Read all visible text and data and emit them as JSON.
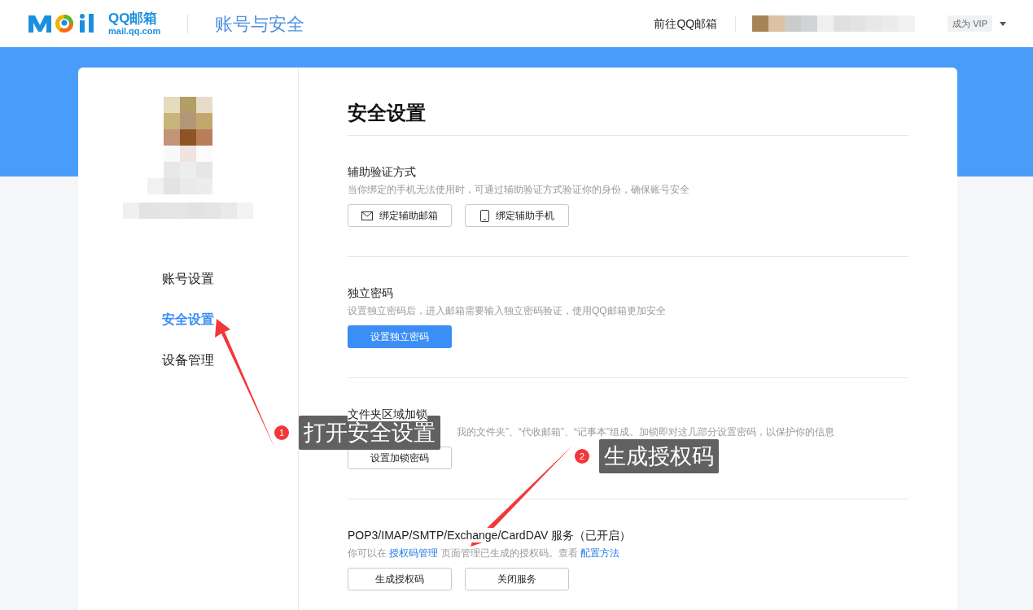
{
  "header": {
    "logo_text": "QQ邮箱",
    "logo_domain": "mail.qq.com",
    "page_title": "账号与安全",
    "goto_link": "前往QQ邮箱",
    "vip_badge": "成为 VIP"
  },
  "sidebar": {
    "items": [
      {
        "label": "账号设置",
        "selected": false
      },
      {
        "label": "安全设置",
        "selected": true
      },
      {
        "label": "设备管理",
        "selected": false
      }
    ]
  },
  "content": {
    "title": "安全设置",
    "sections": [
      {
        "title": "辅助验证方式",
        "description": "当你绑定的手机无法使用时，可通过辅助验证方式验证你的身份，确保账号安全",
        "buttons": [
          {
            "label": "绑定辅助邮箱",
            "kind": "mail"
          },
          {
            "label": "绑定辅助手机",
            "kind": "phone"
          }
        ]
      },
      {
        "title": "独立密码",
        "description": "设置独立密码后，进入邮箱需要输入独立密码验证，使用QQ邮箱更加安全",
        "buttons": [
          {
            "label": "设置独立密码",
            "kind": "primary"
          }
        ]
      },
      {
        "title": "文件夹区域加锁",
        "description": "我的文件夹”、“代收邮箱”、“记事本”组成。加锁即对这几部分设置密码，以保护你的信息",
        "buttons": [
          {
            "label": "设置加锁密码",
            "kind": "outline"
          }
        ]
      },
      {
        "title": "POP3/IMAP/SMTP/Exchange/CardDAV 服务（已开启）",
        "description_parts": [
          {
            "text": "你可以在 ",
            "kind": "text"
          },
          {
            "text": "授权码管理",
            "kind": "link"
          },
          {
            "text": " 页面管理已生成的授权码。查看 ",
            "kind": "text"
          },
          {
            "text": "配置方法",
            "kind": "link"
          }
        ],
        "buttons": [
          {
            "label": "生成授权码",
            "kind": "outline"
          },
          {
            "label": "关闭服务",
            "kind": "outline"
          }
        ]
      }
    ]
  },
  "annotations": [
    {
      "number": "1",
      "text": "打开安全设置"
    },
    {
      "number": "2",
      "text": "生成授权码"
    }
  ]
}
